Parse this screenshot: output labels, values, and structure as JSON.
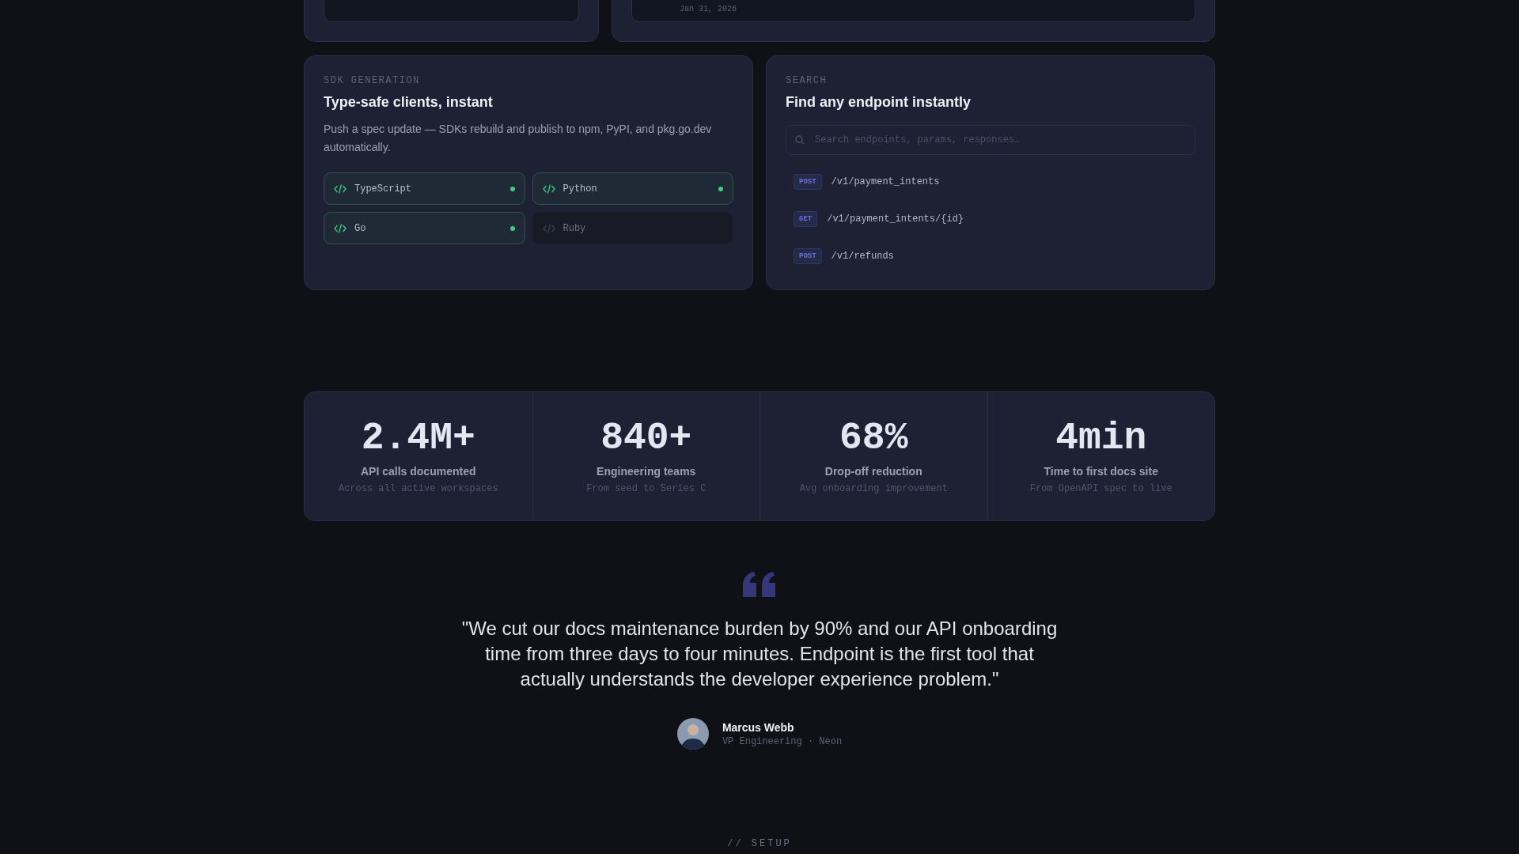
{
  "top_cards": {
    "date": "Jan 31, 2026"
  },
  "sdk_card": {
    "eyebrow": "SDK GENERATION",
    "title": "Type-safe clients, instant",
    "body": "Push a spec update — SDKs rebuild and publish to npm, PyPI, and pkg.go.dev automatically.",
    "languages": [
      {
        "name": "TypeScript",
        "enabled": true
      },
      {
        "name": "Python",
        "enabled": true
      },
      {
        "name": "Go",
        "enabled": true
      },
      {
        "name": "Ruby",
        "enabled": false
      }
    ]
  },
  "search_card": {
    "eyebrow": "SEARCH",
    "title": "Find any endpoint instantly",
    "search": {
      "placeholder": "Search endpoints, params, responses…"
    },
    "results": [
      {
        "method": "POST",
        "path": "/v1/payment_intents"
      },
      {
        "method": "GET",
        "path": "/v1/payment_intents/{id}"
      },
      {
        "method": "POST",
        "path": "/v1/refunds"
      }
    ]
  },
  "stats": [
    {
      "value": "2.4M+",
      "label": "API calls documented",
      "note": "Across all active workspaces"
    },
    {
      "value": "840+",
      "label": "Engineering teams",
      "note": "From seed to Series C"
    },
    {
      "value": "68%",
      "label": "Drop-off reduction",
      "note": "Avg onboarding improvement"
    },
    {
      "value": "4min",
      "label": "Time to first docs site",
      "note": "From OpenAPI spec to live"
    }
  ],
  "testimonial": {
    "quote": "\"We cut our docs maintenance burden by 90% and our API onboarding time from three days to four minutes. Endpoint is the first tool that actually understands the developer experience problem.\"",
    "author": "Marcus Webb",
    "role": "VP Engineering · Neon"
  },
  "next_section": {
    "eyebrow": "// SETUP"
  }
}
